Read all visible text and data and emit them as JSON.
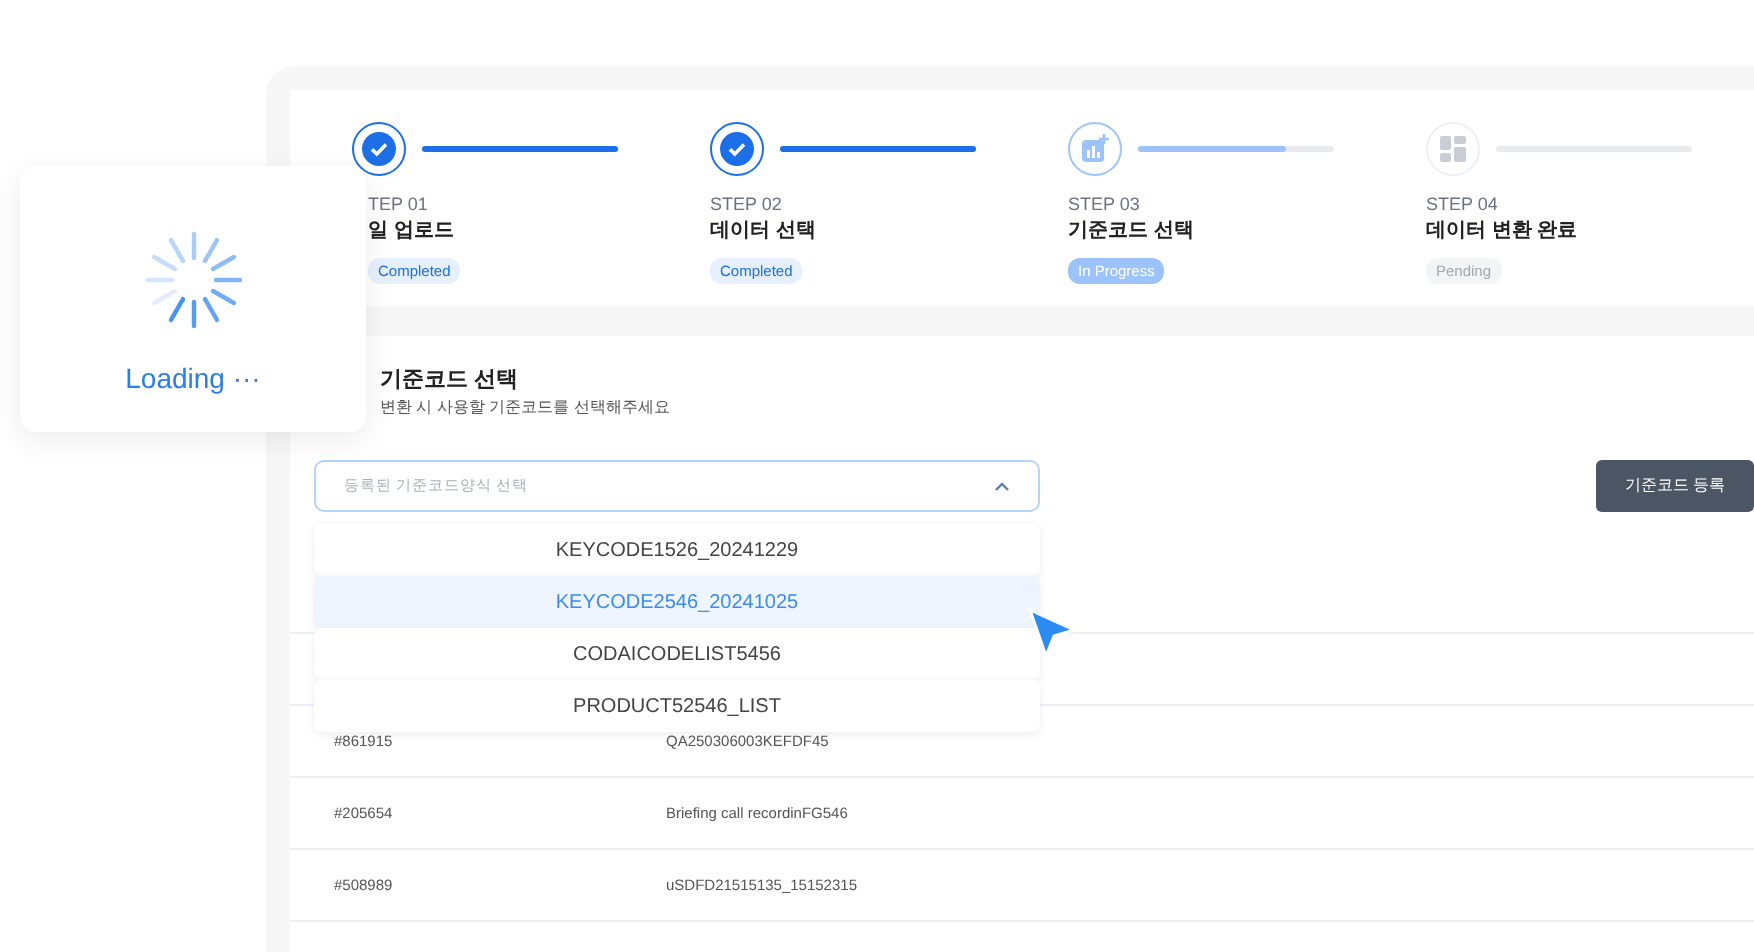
{
  "loading": {
    "text": "Loading ···"
  },
  "steps": [
    {
      "label": "TEP 01",
      "title": "일 업로드",
      "status": "Completed",
      "kind": "completed",
      "level": 1
    },
    {
      "label": "STEP 02",
      "title": "데이터 선택",
      "status": "Completed",
      "kind": "completed",
      "level": 1
    },
    {
      "label": "STEP 03",
      "title": "기준코드 선택",
      "status": "In Progress",
      "kind": "in_progress",
      "level": 0.75
    },
    {
      "label": "STEP 04",
      "title": "데이터 변환 완료",
      "status": "Pending",
      "kind": "pending",
      "level": 0
    }
  ],
  "section": {
    "title": "기준코드 선택",
    "subtitle": "변환 시 사용할 기준코드를 선택해주세요"
  },
  "select": {
    "placeholder": "등록된 기준코드양식 선택",
    "expanded": true
  },
  "options": [
    {
      "label": "KEYCODE1526_20241229",
      "selected": false
    },
    {
      "label": "KEYCODE2546_20241025",
      "selected": true
    },
    {
      "label": "CODAICODELIST5456",
      "selected": false
    },
    {
      "label": "PRODUCT52546_LIST",
      "selected": false
    }
  ],
  "register_button": "기준코드 등록",
  "table": {
    "rows": [
      {
        "id": "#861915",
        "name": "QA250306003KEFDF45"
      },
      {
        "id": "#205654",
        "name": "Briefing call recordinFG546"
      },
      {
        "id": "#508989",
        "name": "uSDFD21515135_15152315"
      }
    ]
  }
}
